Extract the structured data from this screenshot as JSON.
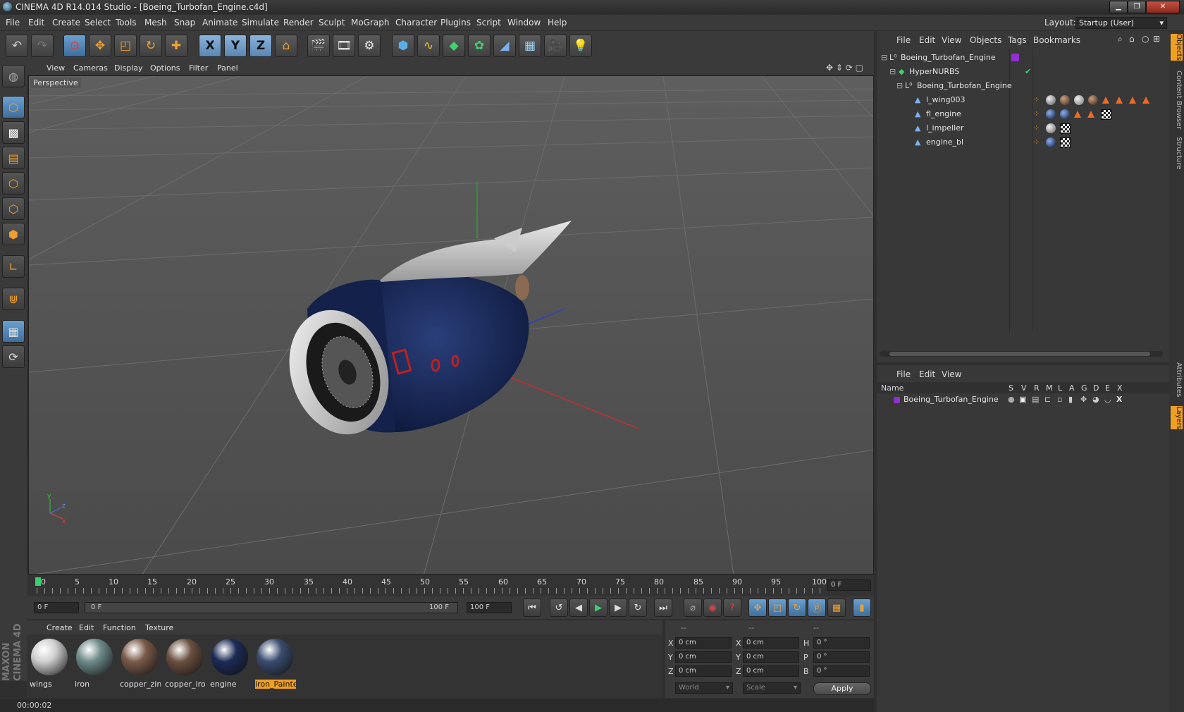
{
  "window": {
    "title": "CINEMA 4D R14.014 Studio - [Boeing_Turbofan_Engine.c4d]",
    "layout_label": "Layout:",
    "layout_value": "Startup (User)"
  },
  "menubar": [
    "File",
    "Edit",
    "Create",
    "Select",
    "Tools",
    "Mesh",
    "Snap",
    "Animate",
    "Simulate",
    "Render",
    "Sculpt",
    "MoGraph",
    "Character",
    "Plugins",
    "Script",
    "Window",
    "Help"
  ],
  "toolbar": {
    "axis_x": "X",
    "axis_y": "Y",
    "axis_z": "Z"
  },
  "viewport": {
    "menu": [
      "View",
      "Cameras",
      "Display",
      "Options",
      "Filter",
      "Panel"
    ],
    "label": "Perspective",
    "axis_labels": {
      "y": "y",
      "z": "z",
      "x": "x"
    }
  },
  "timeline": {
    "ticks": [
      "0",
      "5",
      "10",
      "15",
      "20",
      "25",
      "30",
      "35",
      "40",
      "45",
      "50",
      "55",
      "60",
      "65",
      "70",
      "75",
      "80",
      "85",
      "90",
      "95",
      "100"
    ],
    "current_frame": "0 F",
    "start_field": "0 F",
    "range_start": "0 F",
    "range_end": "100 F",
    "end_field": "100 F"
  },
  "materials": {
    "menu": [
      "Create",
      "Edit",
      "Function",
      "Texture"
    ],
    "items": [
      {
        "name": "wings",
        "color": "#cfcfcf"
      },
      {
        "name": "iron",
        "color": "#6e8a8a"
      },
      {
        "name": "copper_zin",
        "color": "#7a5a48"
      },
      {
        "name": "copper_iro",
        "color": "#6a5040"
      },
      {
        "name": "engine",
        "color": "#1c2a55"
      },
      {
        "name": "iron_Painte",
        "color": "#3a4c70",
        "selected": true
      }
    ]
  },
  "coordinates": {
    "header": [
      "--",
      "--",
      "--"
    ],
    "rows": [
      {
        "a": "X",
        "av": "0 cm",
        "b": "X",
        "bv": "0 cm",
        "c": "H",
        "cv": "0 °"
      },
      {
        "a": "Y",
        "av": "0 cm",
        "b": "Y",
        "bv": "0 cm",
        "c": "P",
        "cv": "0 °"
      },
      {
        "a": "Z",
        "av": "0 cm",
        "b": "Z",
        "bv": "0 cm",
        "c": "B",
        "cv": "0 °"
      }
    ],
    "mode": "World",
    "scale": "Scale",
    "apply": "Apply"
  },
  "status": {
    "time": "00:00:02"
  },
  "objects_panel": {
    "menu": [
      "File",
      "Edit",
      "View",
      "Objects",
      "Tags",
      "Bookmarks"
    ],
    "rows": [
      {
        "name": "Boeing_Turbofan_Engine"
      },
      {
        "name": "HyperNURBS"
      },
      {
        "name": "Boeing_Turbofan_Engine"
      },
      {
        "name": "l_wing003"
      },
      {
        "name": "fl_engine"
      },
      {
        "name": "l_impeller"
      },
      {
        "name": "engine_bl"
      }
    ]
  },
  "layers_panel": {
    "menu": [
      "File",
      "Edit",
      "View"
    ],
    "columns": [
      "Name",
      "S",
      "V",
      "R",
      "M",
      "L",
      "A",
      "G",
      "D",
      "E",
      "X"
    ],
    "rows": [
      {
        "name": "Boeing_Turbofan_Engine"
      }
    ]
  },
  "right_tabs": [
    "Objects",
    "Content Browser",
    "Structure",
    "Attributes",
    "Layers"
  ],
  "branding": "MAXON CINEMA 4D"
}
